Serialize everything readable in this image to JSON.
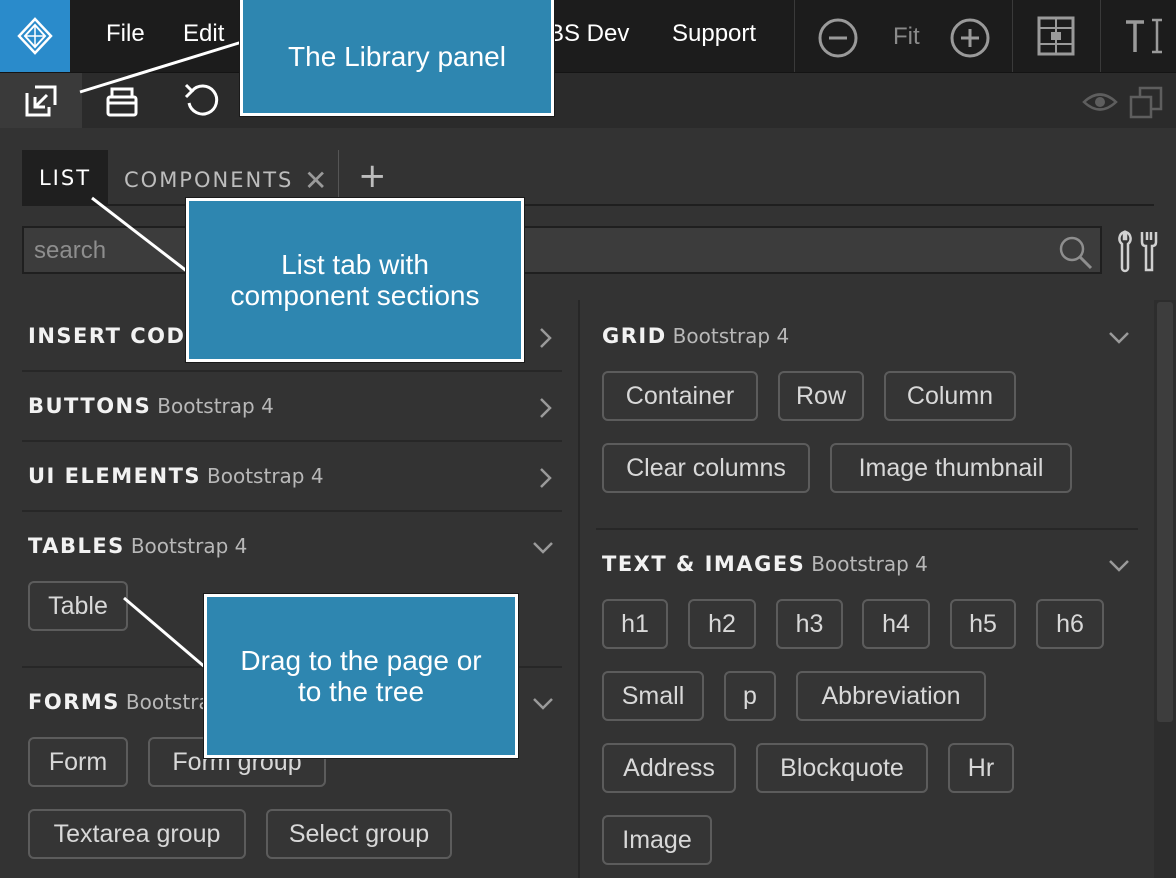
{
  "menubar": {
    "items": [
      "File",
      "Edit",
      "BS Dev",
      "Support"
    ],
    "zoom_fit": "Fit"
  },
  "tabs": {
    "list": "LIST",
    "components": "COMPONENTS"
  },
  "search": {
    "placeholder": "search"
  },
  "left_sections": [
    {
      "title": "INSERT CODE",
      "subtitle": "",
      "expanded": false,
      "items": []
    },
    {
      "title": "BUTTONS",
      "subtitle": "Bootstrap 4",
      "expanded": false,
      "items": []
    },
    {
      "title": "UI ELEMENTS",
      "subtitle": "Bootstrap 4",
      "expanded": false,
      "items": []
    },
    {
      "title": "TABLES",
      "subtitle": "Bootstrap 4",
      "expanded": true,
      "items": [
        "Table"
      ]
    },
    {
      "title": "FORMS",
      "subtitle": "Bootstrap 4",
      "expanded": true,
      "items": [
        "Form",
        "Form group",
        "Textarea group",
        "Select group"
      ]
    }
  ],
  "right_sections": [
    {
      "title": "GRID",
      "subtitle": "Bootstrap 4",
      "expanded": true,
      "items": [
        "Container",
        "Row",
        "Column",
        "Clear columns",
        "Image thumbnail"
      ]
    },
    {
      "title": "TEXT & IMAGES",
      "subtitle": "Bootstrap 4",
      "expanded": true,
      "items": [
        "h1",
        "h2",
        "h3",
        "h4",
        "h5",
        "h6",
        "Small",
        "p",
        "Abbreviation",
        "Address",
        "Blockquote",
        "Hr",
        "Image"
      ]
    }
  ],
  "callouts": {
    "library_panel": "The Library panel",
    "list_tab_line1": "List tab with",
    "list_tab_line2": "component sections",
    "drag_line1": "Drag to the page or",
    "drag_line2": "to the tree"
  },
  "colors": {
    "accent": "#2a8bcb",
    "callout": "#2e86b0",
    "background": "#333333",
    "menubar": "#1c1c1c"
  }
}
